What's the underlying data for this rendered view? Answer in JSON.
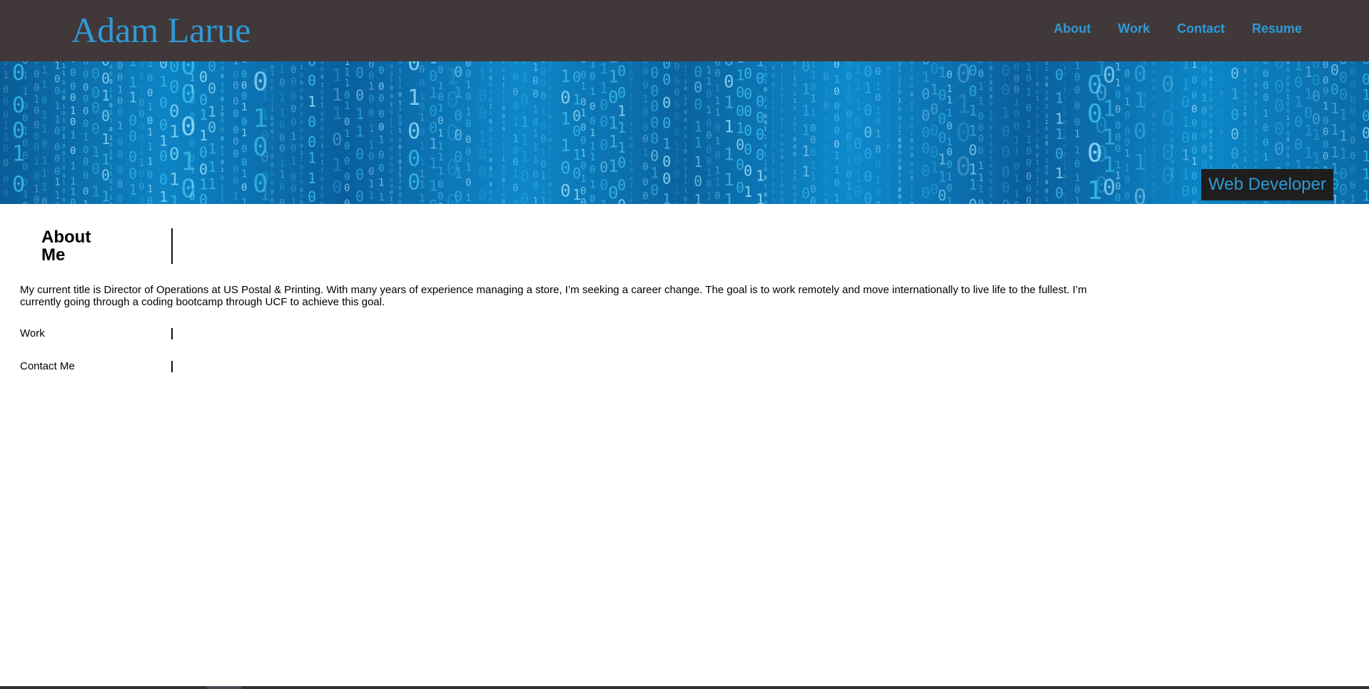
{
  "header": {
    "brand": "Adam Larue",
    "nav": [
      "About",
      "Work",
      "Contact",
      "Resume"
    ]
  },
  "hero": {
    "badge": "Web Developer"
  },
  "about": {
    "title": "About Me",
    "text": "My current title is Director of Operations at US Postal & Printing. With many years of experience managing a store, I’m seeking a career change. The goal is to work remotely and move internationally to live life to the fullest. I’m currently going through a coding bootcamp through UCF to achieve this goal."
  },
  "sections": {
    "work": "Work",
    "contact": "Contact Me"
  },
  "colors": {
    "header_bg": "#403839",
    "accent": "#2f9ad6",
    "badge_bg": "#1e1e1e"
  }
}
